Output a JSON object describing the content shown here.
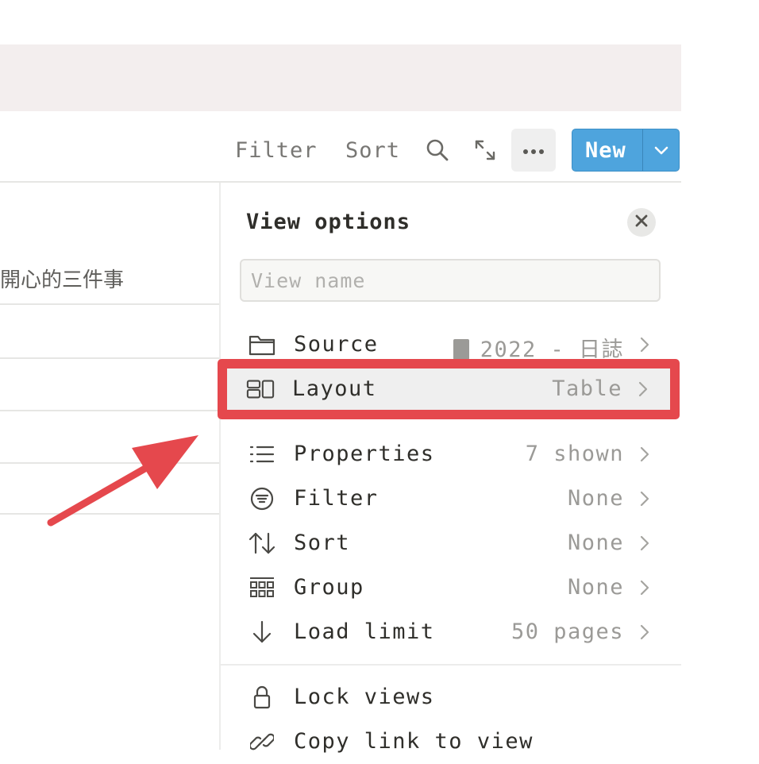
{
  "toolbar": {
    "filter_label": "Filter",
    "sort_label": "Sort",
    "search_icon": "search-icon",
    "expand_icon": "expand-icon",
    "more_icon": "more-icon",
    "new_label": "New"
  },
  "table": {
    "first_row_text": "開心的三件事"
  },
  "view_options": {
    "title": "View options",
    "view_name_placeholder": "View name",
    "items": [
      {
        "icon": "folder-icon",
        "label": "Source",
        "value": "2022 - 日誌"
      },
      {
        "icon": "layout-icon",
        "label": "Layout",
        "value": "Table"
      },
      {
        "icon": "list-icon",
        "label": "Properties",
        "value": "7 shown"
      },
      {
        "icon": "filter-icon",
        "label": "Filter",
        "value": "None"
      },
      {
        "icon": "sort-icon",
        "label": "Sort",
        "value": "None"
      },
      {
        "icon": "group-icon",
        "label": "Group",
        "value": "None"
      },
      {
        "icon": "arrow-down-icon",
        "label": "Load limit",
        "value": "50 pages"
      },
      {
        "icon": "lock-icon",
        "label": "Lock views",
        "value": ""
      },
      {
        "icon": "link-icon",
        "label": "Copy link to view",
        "value": ""
      }
    ]
  },
  "colors": {
    "accent": "#4ea4dd",
    "highlight": "#e5484d",
    "banner": "#f3eeee"
  }
}
